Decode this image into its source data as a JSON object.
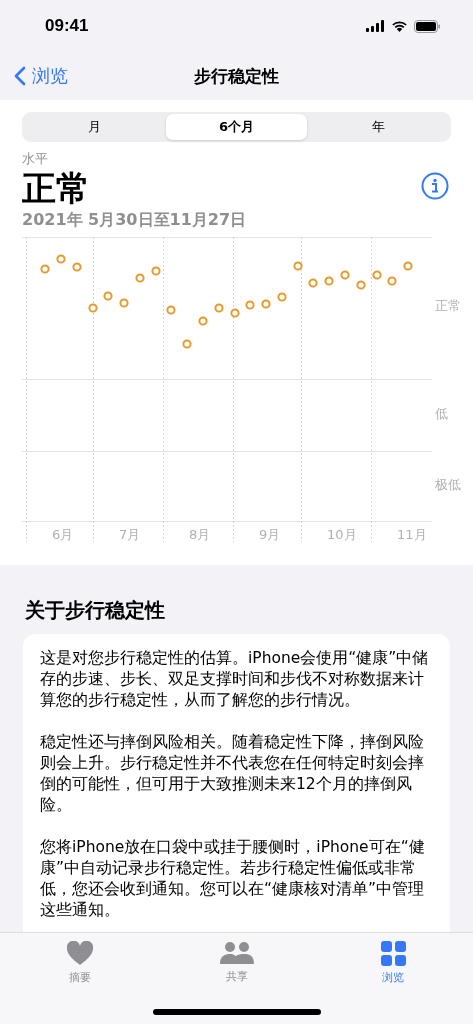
{
  "status_bar": {
    "time": "09:41"
  },
  "nav": {
    "back": "浏览",
    "title": "步行稳定性"
  },
  "segments": [
    {
      "label": "月",
      "selected": false
    },
    {
      "label": "6个月",
      "selected": true
    },
    {
      "label": "年",
      "selected": false
    }
  ],
  "summary": {
    "caption": "水平",
    "value": "正常",
    "date_range": "2021年 5月30日至11月27日"
  },
  "chart": {
    "x_labels": [
      "6月",
      "7月",
      "8月",
      "9月",
      "10月",
      "11月"
    ],
    "y_labels": [
      "正常",
      "低",
      "极低"
    ]
  },
  "about": {
    "heading": "关于步行稳定性",
    "paragraphs": [
      "这是对您步行稳定性的估算。iPhone会使用“健康”中储存的步速、步长、双足支撑时间和步伐不对称数据来计算您的步行稳定性，从而了解您的步行情况。",
      "稳定性还与摔倒风险相关。随着稳定性下降，摔倒风险则会上升。步行稳定性并不代表您在任何特定时刻会摔倒的可能性，但可用于大致推测未来12个月的摔倒风险。",
      "您将iPhone放在口袋中或挂于腰侧时，iPhone可在“健康”中自动记录步行稳定性。若步行稳定性偏低或非常低，您还会收到通知。您可以在“健康核对清单”中管理这些通知。"
    ]
  },
  "tab_bar": [
    {
      "kind": "heart",
      "label": "摘要",
      "selected": false
    },
    {
      "kind": "people",
      "label": "共享",
      "selected": false
    },
    {
      "kind": "grid",
      "label": "浏览",
      "selected": true
    }
  ]
}
